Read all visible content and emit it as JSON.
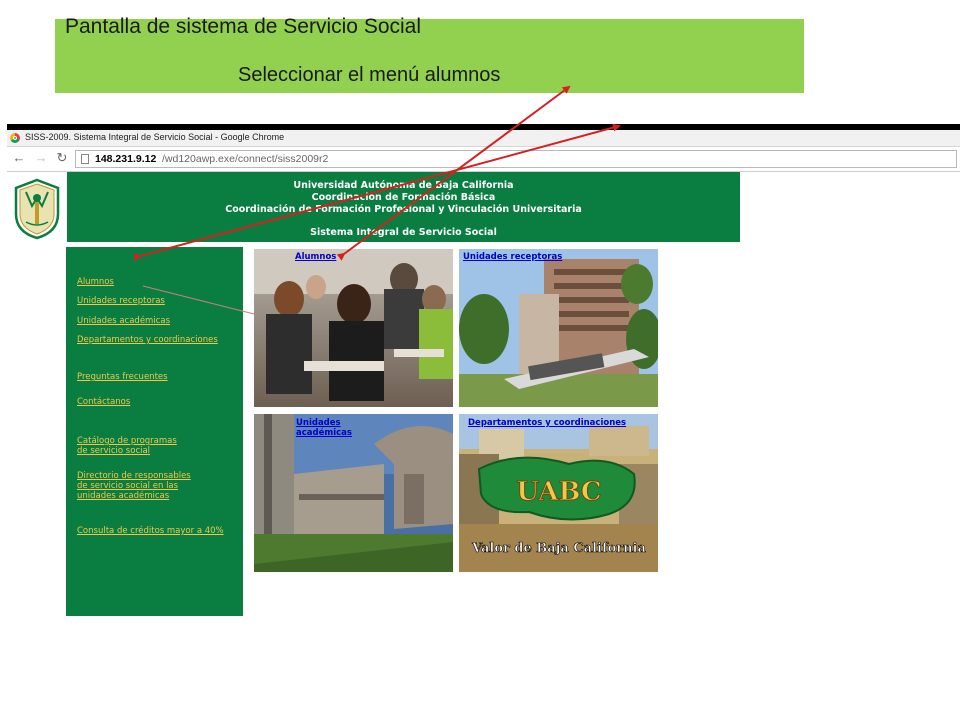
{
  "banner": {
    "title": "Pantalla de sistema de Servicio Social",
    "subtitle": "Seleccionar el menú alumnos"
  },
  "browser": {
    "window_title": "SISS-2009. Sistema Integral de Servicio Social - Google Chrome",
    "url_host": "148.231.9.12",
    "url_path": "/wd120awp.exe/connect/siss2009r2"
  },
  "header": {
    "line1": "Universidad Autónoma de Baja California",
    "line2": "Coordinación de Formación Básica",
    "line3": "Coordinación de Formación Profesional y Vinculación Universitaria",
    "line4": "Sistema Integral de Servicio Social"
  },
  "sidebar": {
    "items": [
      "Alumnos",
      "Unidades receptoras",
      "Unidades académicas",
      "Departamentos y coordinaciones",
      "Preguntas frecuentes",
      "Contáctanos",
      "Catálogo de programas\nde servicio social",
      "Directorio de responsables\nde servicio social en las\nunidades académicas",
      "Consulta de créditos mayor a 40%"
    ]
  },
  "tiles": {
    "alumnos": "Alumnos",
    "receptoras": "Unidades receptoras",
    "academicas": "Unidades\nacadémicas",
    "departamentos": "Departamentos y coordinaciones",
    "uabc_logo": "UABC",
    "uabc_slogan": "Valor de Baja California"
  },
  "colors": {
    "banner": "#92d050",
    "uabc_green": "#0a7d41",
    "sidebar_link": "#f2c84a",
    "tile_link": "#0000cc",
    "arrow": "#d62020"
  }
}
